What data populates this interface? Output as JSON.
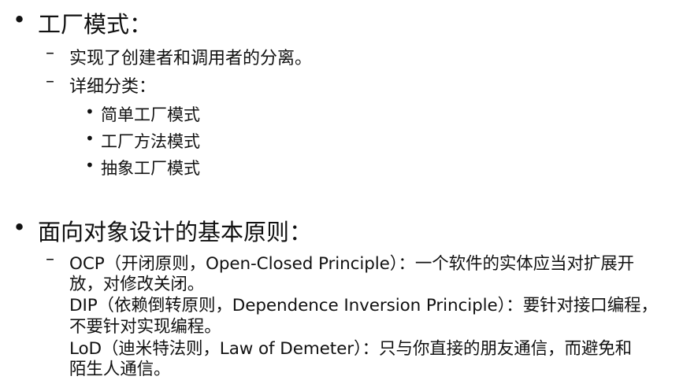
{
  "sections": [
    {
      "title": "工厂模式：",
      "items": [
        "实现了创建者和调用者的分离。",
        "详细分类："
      ],
      "subitems": [
        "简单工厂模式",
        "工厂方法模式",
        "抽象工厂模式"
      ]
    },
    {
      "title": "面向对象设计的基本原则：",
      "principles": [
        {
          "line1": "OCP（开闭原则，Open-Closed Principle）：一个软件的实体应当对扩展开",
          "line2": "放，对修改关闭。"
        },
        {
          "line1": "DIP（依赖倒转原则，Dependence Inversion Principle）：要针对接口编程，",
          "line2": "不要针对实现编程。"
        },
        {
          "line1": "LoD（迪米特法则，Law of Demeter）：只与你直接的朋友通信，而避免和",
          "line2": "陌生人通信。"
        }
      ]
    }
  ],
  "markers": {
    "bullet": "•",
    "dash": "–"
  }
}
